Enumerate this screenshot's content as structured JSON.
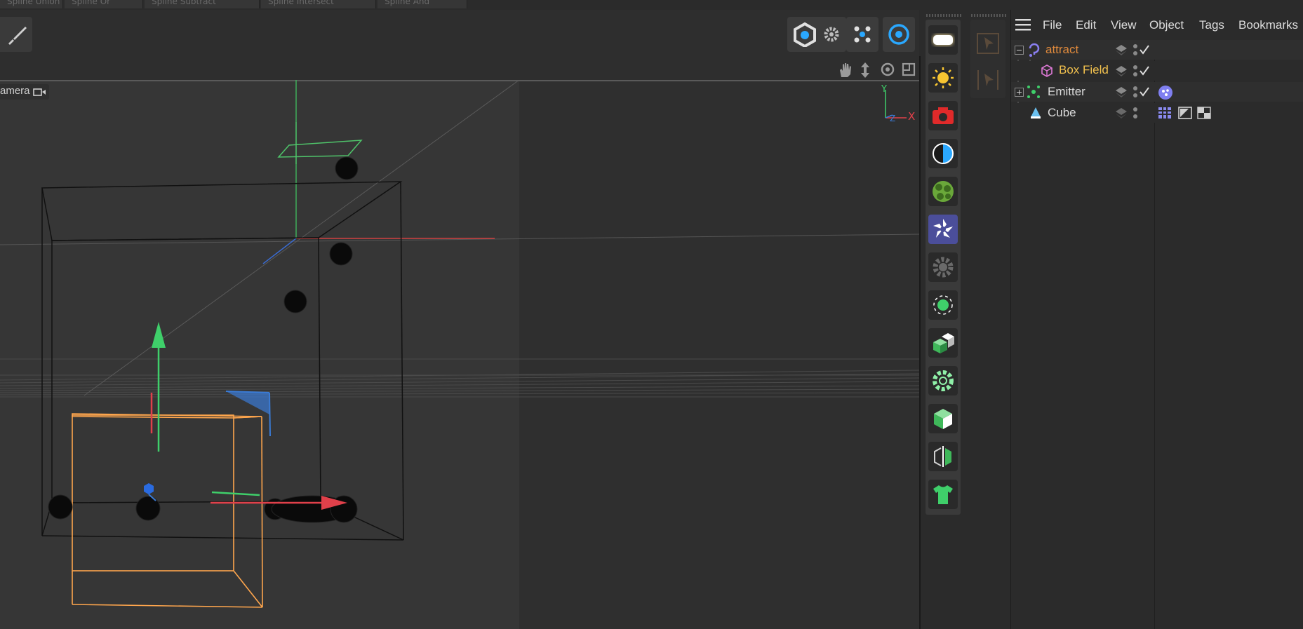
{
  "top_tabs": [
    "Spline Union",
    "Spline Or",
    "Spline Subtract",
    "Spline Intersect",
    "Spline And"
  ],
  "viewport": {
    "camera_label": "amera",
    "axis_labels": {
      "y": "Y",
      "z": "Z",
      "x": "X"
    }
  },
  "menubar": {
    "items": [
      "File",
      "Edit",
      "View",
      "Object",
      "Tags",
      "Bookmarks"
    ]
  },
  "objects": [
    {
      "name": "attract",
      "color": "#e08a3c"
    },
    {
      "name": "Box Field",
      "color": "#f2c14e"
    },
    {
      "name": "Emitter",
      "color": "#dcdcdc"
    },
    {
      "name": "Cube",
      "color": "#dcdcdc"
    }
  ],
  "palette_icons": [
    "light-panel-icon",
    "sun-icon",
    "camera-icon",
    "contrast-icon",
    "cluster-icon",
    "octane-icon",
    "gear-icon",
    "point-light-icon",
    "cubes-icon",
    "flower-gear-icon",
    "cube-icon",
    "symmetry-icon",
    "shirt-icon"
  ],
  "colors": {
    "accent_blue": "#2aa8ff",
    "attract": "#e08a3c",
    "box_field": "#f2c14e",
    "selection_orange": "#ffa64d"
  }
}
